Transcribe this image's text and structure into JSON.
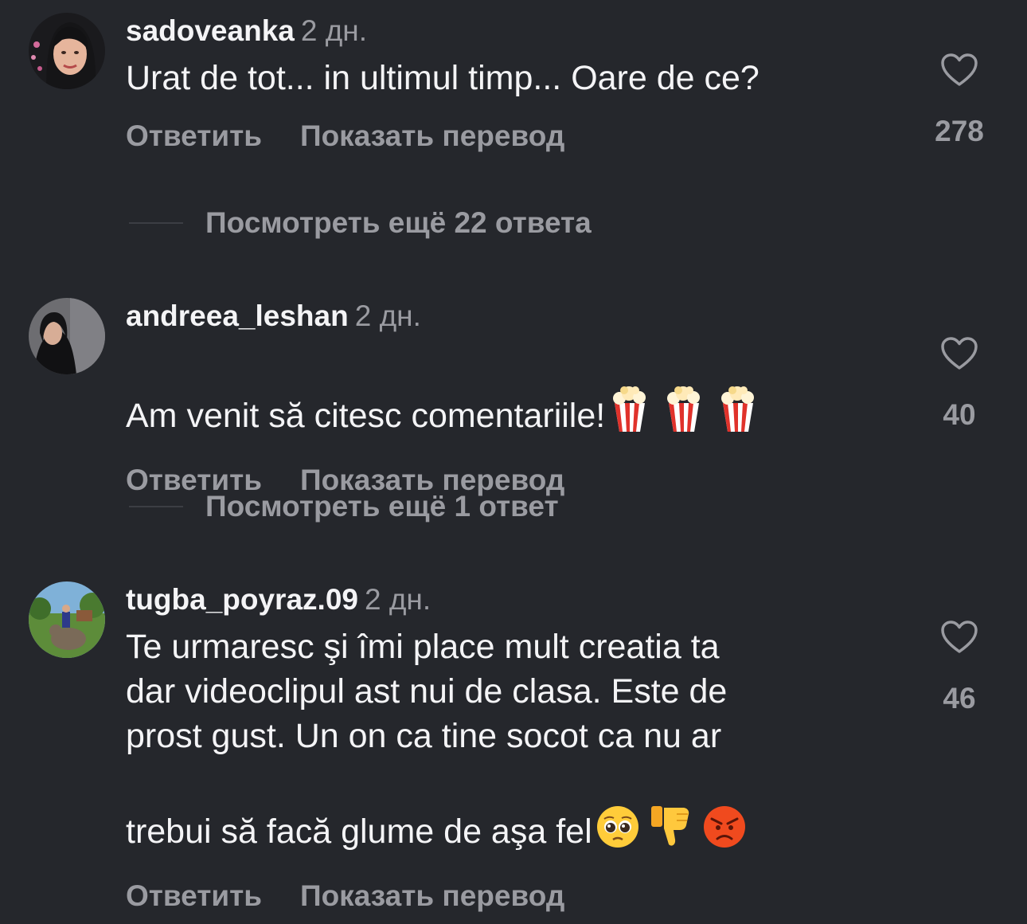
{
  "comments": [
    {
      "username": "sadoveanka",
      "time": "2 дн.",
      "text": "Urat de tot... in ultimul timp... Oare de ce?",
      "emojis": [],
      "reply_label": "Ответить",
      "translate_label": "Показать перевод",
      "likes": "278",
      "more_replies": "Посмотреть ещё 22 ответа"
    },
    {
      "username": "andreea_leshan",
      "time": "2 дн.",
      "text": "Am venit să citesc comentariile!",
      "emojis": [
        "popcorn-icon",
        "popcorn-icon",
        "popcorn-icon"
      ],
      "reply_label": "Ответить",
      "translate_label": "Показать перевод",
      "likes": "40",
      "more_replies": "Посмотреть ещё 1 ответ"
    },
    {
      "username": "tugba_poyraz.09",
      "time": "2 дн.",
      "text": "Te urmaresc şi îmi place mult creatia ta\ndar videoclipul ast nui de clasa. Este de\nprost gust. Un on ca tine socot ca nu ar\ntrebui să facă glume de aşa fel",
      "emojis": [
        "pleading-face-icon",
        "thumbs-down-icon",
        "angry-face-icon"
      ],
      "reply_label": "Ответить",
      "translate_label": "Показать перевод",
      "likes": "46"
    }
  ],
  "colors": {
    "background": "#25272c",
    "primary_text": "#f4f4f6",
    "secondary_text": "#9a9ba1"
  }
}
